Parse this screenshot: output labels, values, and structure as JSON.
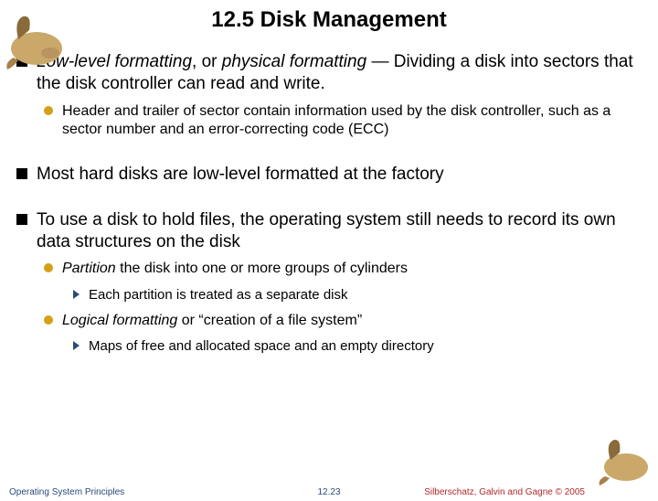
{
  "title": "12.5 Disk Management",
  "bullets": {
    "p1_a": "Low-level formatting",
    "p1_b": ", or ",
    "p1_c": "physical formatting",
    "p1_d": " — Dividing a disk into sectors that the disk controller can read and write.",
    "p1_sub1": "Header and trailer of sector contain information used by the disk controller, such as a sector number and an error-correcting code (ECC)",
    "p2": "Most hard disks are low-level formatted at the factory",
    "p3": "To use a disk to hold files, the operating system still needs to record its own data structures on the disk",
    "p3_sub1_a": "Partition",
    "p3_sub1_b": " the disk into one or more groups of cylinders",
    "p3_sub1_sub1": "Each partition is treated as a separate disk",
    "p3_sub2_a": "Logical formatting",
    "p3_sub2_b": " or “creation of a file system”",
    "p3_sub2_sub1": "Maps of free and allocated space and an empty directory"
  },
  "footer": {
    "left": "Operating System Principles",
    "center": "12.23",
    "right": "Silberschatz, Galvin and Gagne © 2005"
  }
}
